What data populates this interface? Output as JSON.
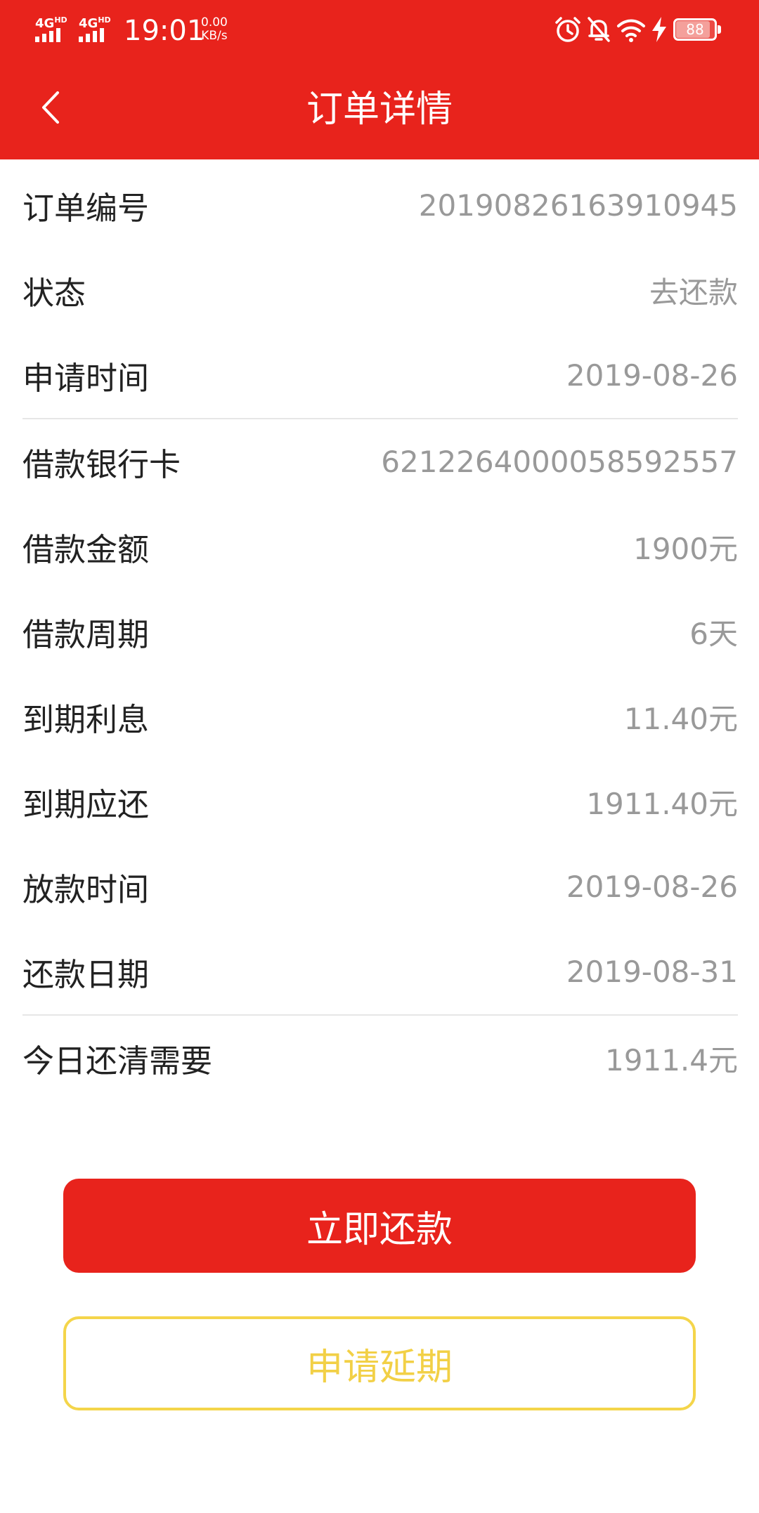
{
  "status_bar": {
    "network_1": "4G",
    "network_1_sup": "HD",
    "network_2": "4G",
    "network_2_sup": "HD",
    "time": "19:01",
    "speed_value": "0.00",
    "speed_unit": "KB/s",
    "battery_level": "88",
    "battery_fraction": 0.88,
    "icons": [
      "alarm-icon",
      "bell-off-icon",
      "wifi-icon",
      "charging-icon",
      "battery-icon"
    ]
  },
  "header": {
    "title": "订单详情",
    "back_icon": "chevron-left-icon"
  },
  "details": {
    "rows": [
      {
        "label": "订单编号",
        "value": "20190826163910945"
      },
      {
        "label": "状态",
        "value": "去还款"
      },
      {
        "label": "申请时间",
        "value": "2019-08-26"
      },
      {
        "label": "借款银行卡",
        "value": "6212264000058592557"
      },
      {
        "label": "借款金额",
        "value": "1900元"
      },
      {
        "label": "借款周期",
        "value": "6天"
      },
      {
        "label": "到期利息",
        "value": "11.40元"
      },
      {
        "label": "到期应还",
        "value": "1911.40元"
      },
      {
        "label": "放款时间",
        "value": "2019-08-26"
      },
      {
        "label": "还款日期",
        "value": "2019-08-31"
      },
      {
        "label": "今日还清需要",
        "value": "1911.4元"
      }
    ]
  },
  "actions": {
    "repay_label": "立即还款",
    "extend_label": "申请延期"
  },
  "colors": {
    "brand_red": "#e8231c",
    "extend_yellow": "#f4d54a",
    "value_gray": "#999999",
    "label_dark": "#222222"
  }
}
